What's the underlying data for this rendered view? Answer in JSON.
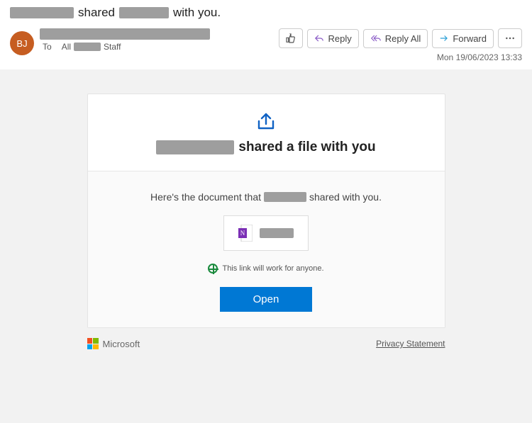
{
  "header": {
    "subject_prefix": "shared",
    "subject_suffix": "with you.",
    "avatar_initials": "BJ",
    "to_prefix": "To",
    "to_before": "All",
    "to_after": "Staff",
    "timestamp": "Mon 19/06/2023 13:33"
  },
  "actions": {
    "reply": "Reply",
    "reply_all": "Reply All",
    "forward": "Forward"
  },
  "card": {
    "title_suffix": "shared a file with you",
    "sentence_before": "Here's the document that",
    "sentence_after": "shared with you.",
    "link_note": "This link will work for anyone.",
    "open": "Open"
  },
  "footer": {
    "brand": "Microsoft",
    "privacy": "Privacy Statement"
  },
  "icons": {
    "thumb": "thumbs-up-icon",
    "reply": "reply-icon",
    "reply_all": "reply-all-icon",
    "forward": "forward-icon",
    "more": "more-icon",
    "share": "share-icon",
    "onenote": "onenote-file-icon",
    "globe": "globe-icon"
  }
}
